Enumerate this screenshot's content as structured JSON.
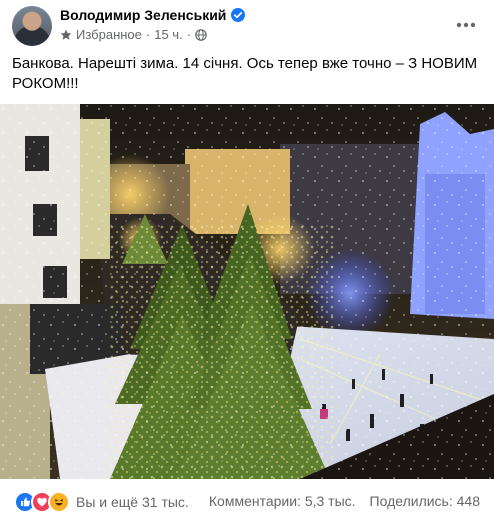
{
  "post": {
    "author": "Володимир Зеленський",
    "meta_label": "Избранное",
    "time": "15 ч.",
    "text": "Банкова. Нарешті зима. 14 січня. Ось тепер вже точно – З НОВИМ РОКОМ!!!"
  },
  "footer": {
    "reactions_text": "Вы и ещё 31 тыс.",
    "comments_text": "Комментарии: 5,3 тыс.",
    "shares_text": "Поделились: 448"
  },
  "colors": {
    "brand_blue": "#1877f2",
    "love_red": "#f33e58",
    "haha_yellow": "#f7b125",
    "secondary_text": "#65676b"
  },
  "icons": [
    "verified-icon",
    "star-icon",
    "globe-icon",
    "more-icon",
    "like-icon",
    "love-icon",
    "haha-icon"
  ]
}
